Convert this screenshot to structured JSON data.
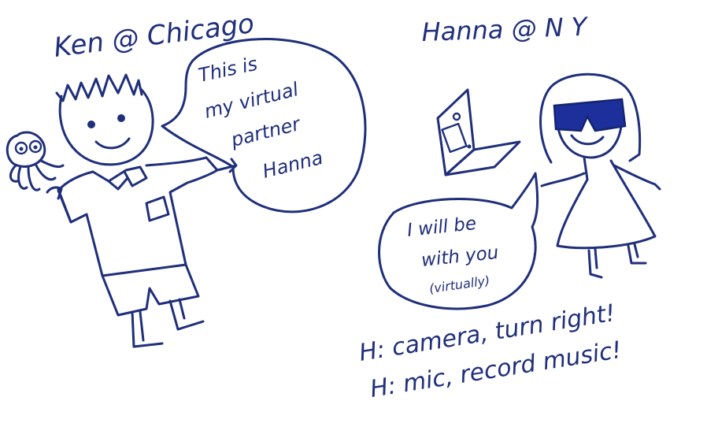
{
  "captions": {
    "ken_label": "Ken @ Chicago",
    "hanna_label": "Hanna @ N Y"
  },
  "ken_bubble": {
    "line1": "This is",
    "line2": "my virtual",
    "line3": "partner",
    "line4": "Hanna"
  },
  "hanna_bubble": {
    "line1": "I will be",
    "line2": "with you",
    "line3": "(virtually)"
  },
  "commands": {
    "line1": "H: camera, turn right!",
    "line2": "H: mic, record music!"
  },
  "colors": {
    "ink": "#1f2f7a",
    "sunglasses": "#1c2f9a",
    "paper": "#ffffff"
  },
  "icons": [
    "octopus-doll-icon",
    "laptop-icon",
    "sunglasses-icon"
  ]
}
